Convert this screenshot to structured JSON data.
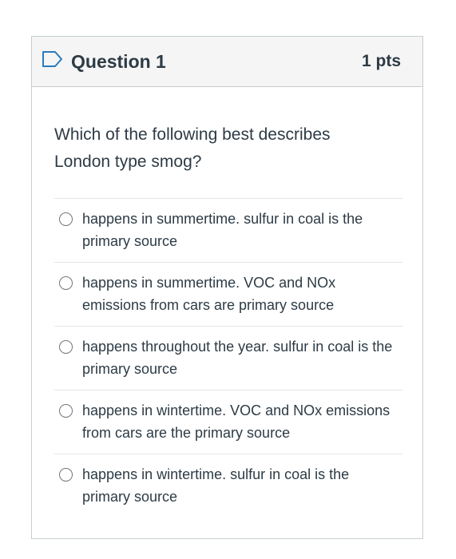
{
  "question": {
    "title": "Question 1",
    "points": "1 pts",
    "text": "Which of the following best describes London type smog?"
  },
  "answers": [
    {
      "label": "happens in summertime. sulfur in coal is the primary source",
      "selected": false
    },
    {
      "label": "happens in summertime. VOC and NOx emissions from cars are primary source",
      "selected": false
    },
    {
      "label": "happens throughout the year. sulfur in coal is the primary source",
      "selected": false
    },
    {
      "label": "happens in wintertime. VOC and NOx emissions from cars are the primary source",
      "selected": false
    },
    {
      "label": "happens in wintertime. sulfur in coal is the primary source",
      "selected": false
    }
  ],
  "icons": {
    "flag": "bookmark-flag-icon"
  },
  "colors": {
    "text": "#2d3b45",
    "border": "#c7cdd1",
    "header_bg": "#f5f5f5",
    "flag_stroke": "#2b7abc"
  }
}
